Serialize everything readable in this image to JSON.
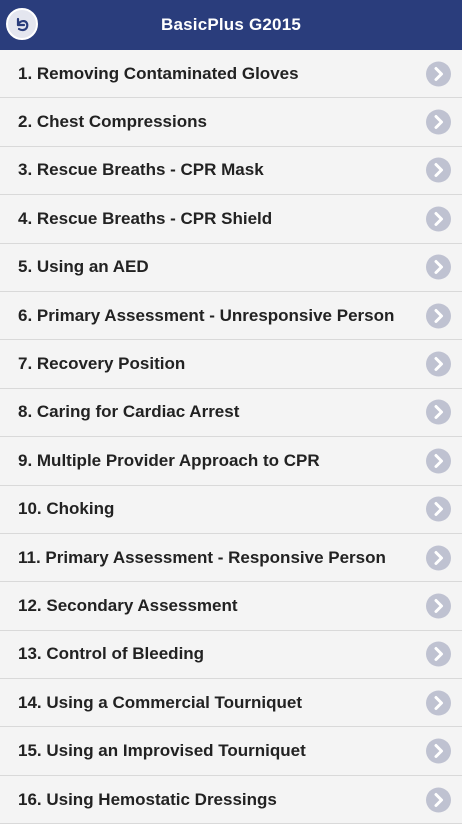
{
  "header": {
    "title": "BasicPlus G2015",
    "back_icon": "back-arrow-icon"
  },
  "list": {
    "items": [
      {
        "label": "1. Removing Contaminated Gloves"
      },
      {
        "label": "2. Chest Compressions"
      },
      {
        "label": "3. Rescue Breaths - CPR Mask"
      },
      {
        "label": "4. Rescue Breaths - CPR Shield"
      },
      {
        "label": "5. Using an AED"
      },
      {
        "label": "6. Primary Assessment - Unresponsive Person"
      },
      {
        "label": "7. Recovery Position"
      },
      {
        "label": "8. Caring for Cardiac Arrest"
      },
      {
        "label": "9. Multiple Provider Approach to CPR"
      },
      {
        "label": "10. Choking"
      },
      {
        "label": "11. Primary Assessment - Responsive Person"
      },
      {
        "label": "12. Secondary Assessment"
      },
      {
        "label": "13. Control of Bleeding"
      },
      {
        "label": "14. Using a Commercial Tourniquet"
      },
      {
        "label": "15. Using an Improvised Tourniquet"
      },
      {
        "label": "16. Using Hemostatic Dressings"
      }
    ],
    "item_icon": "chevron-right-icon"
  },
  "colors": {
    "header_bg": "#2a3d7c",
    "row_bg": "#f4f4f4",
    "chevron_bg": "#bfc2d1"
  }
}
